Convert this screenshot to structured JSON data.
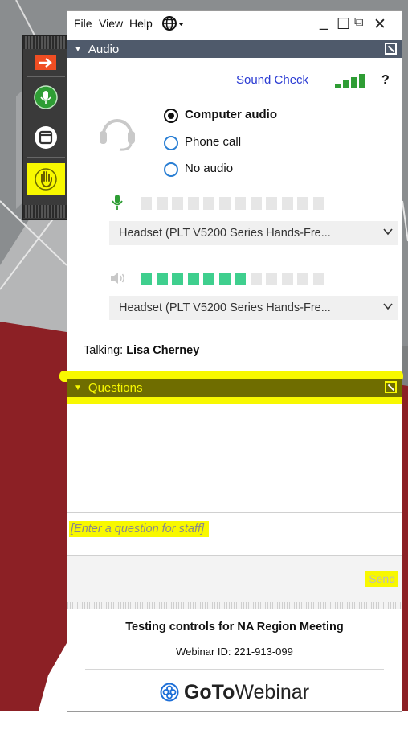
{
  "menu": {
    "file": "File",
    "view": "View",
    "help": "Help"
  },
  "window_controls": {
    "minimize": "_",
    "restore": "☐",
    "popout": "⧉",
    "close": "✕"
  },
  "audio_panel": {
    "title": "Audio",
    "sound_check": "Sound Check",
    "help": "?",
    "options": [
      {
        "label": "Computer audio",
        "selected": true
      },
      {
        "label": "Phone call",
        "selected": false
      },
      {
        "label": "No audio",
        "selected": false
      }
    ],
    "mic_level": {
      "active": 0,
      "total": 12
    },
    "speaker_level": {
      "active": 7,
      "total": 12
    },
    "microphone_device": "Headset (PLT V5200 Series Hands-Fre...",
    "speaker_device": "Headset (PLT V5200 Series Hands-Fre...",
    "talking_label": "Talking:",
    "talking_name": "Lisa Cherney"
  },
  "questions_panel": {
    "title": "Questions",
    "placeholder": "[Enter a question for staff]",
    "send_label": "Send"
  },
  "footer": {
    "title": "Testing controls for NA Region Meeting",
    "webinar_id": "Webinar ID: 221-913-099",
    "logo_bold": "GoTo",
    "logo_light": "Webinar"
  },
  "colors": {
    "panel_header": "#4f5a6b",
    "highlight": "#f8f800",
    "link_blue": "#2a3bd3",
    "mic_green": "#2e9d34",
    "meter_green": "#3fcf8e",
    "toolbar_orange": "#f04e23",
    "background_red": "#8c2025"
  }
}
